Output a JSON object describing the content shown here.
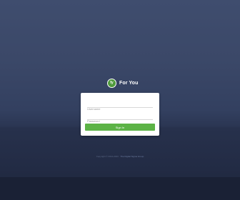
{
  "brand": {
    "name": "For You",
    "logo_letters": "fy",
    "accent_color": "#5cb346"
  },
  "login": {
    "username_placeholder": "Username",
    "password_placeholder": "Password",
    "signin_label": "Sign In"
  },
  "footer": {
    "copyright": "Copyright © 2012-2023 ·",
    "link_label": "The Digital Sigma Group"
  }
}
